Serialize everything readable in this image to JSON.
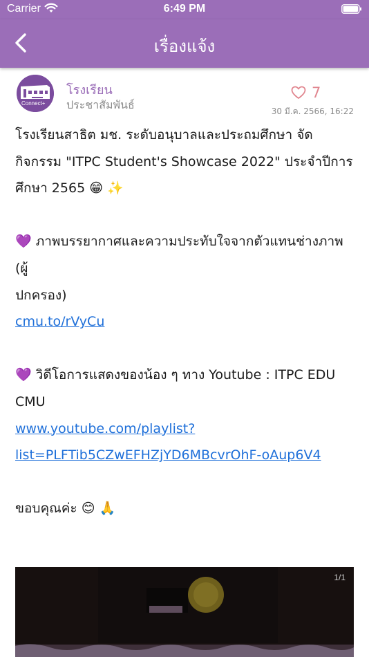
{
  "status_bar": {
    "carrier": "Carrier",
    "time": "6:49 PM"
  },
  "navbar": {
    "title": "เรื่องแจ้ง",
    "background_color": "#9b6eb8"
  },
  "post": {
    "author": "โรงเรียน",
    "category": "ประชาสัมพันธ์",
    "likes": "7",
    "date": "30 มี.ค. 2566, 16:22",
    "avatar_text": "Connect+",
    "body": {
      "line1": "โรงเรียนสาธิต มช. ระดับอนุบาลและประถมศึกษา จัด",
      "line2": "กิจกรรม \"ITPC Student's Showcase 2022\" ประจำปีการ",
      "line3": "ศึกษา 2565 😁 ✨",
      "item1_text": "💜 ภาพบรรยากาศและความประทับใจจากตัวแทนช่างภาพ (ผู้",
      "item1_text_cont": "ปกครอง)",
      "item1_link": "cmu.to/rVyCu",
      "item2_text": "💜 วิดีโอการแสดงของน้อง ๆ ทาง Youtube : ITPC EDU",
      "item2_text_cont": "CMU",
      "item2_link_line1": "www.youtube.com/playlist?",
      "item2_link_line2": "list=PLFTib5CZwEFHZjYD6MBcvrOhF-oAup6V4",
      "closing": "ขอบคุณค่ะ 😊 🙏"
    },
    "media": {
      "counter": "1/1"
    }
  },
  "colors": {
    "accent": "#9b6eb8",
    "like": "#e1868f",
    "link": "#1e6fd9",
    "muted": "#8a8a8a"
  }
}
